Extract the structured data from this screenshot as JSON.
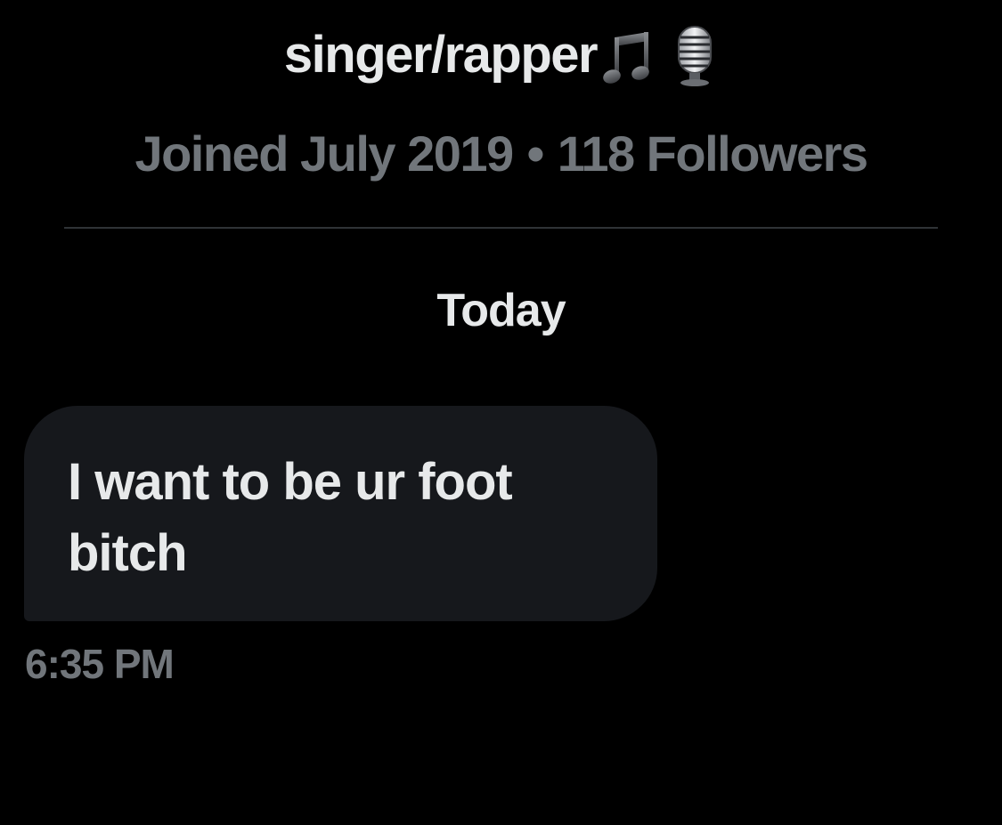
{
  "profile": {
    "bio": "singer/rapper",
    "bio_icons": [
      "musical-notes-icon",
      "studio-microphone-icon"
    ],
    "joined": "Joined July 2019",
    "separator": "•",
    "followers": "118 Followers"
  },
  "conversation": {
    "day_label": "Today",
    "messages": [
      {
        "text": "I want to be ur foot bitch",
        "time": "6:35 PM"
      }
    ]
  },
  "colors": {
    "background": "#000000",
    "primary_text": "#e7e9ea",
    "secondary_text": "#71767b",
    "bubble": "#16181c",
    "divider": "#2f3336"
  }
}
